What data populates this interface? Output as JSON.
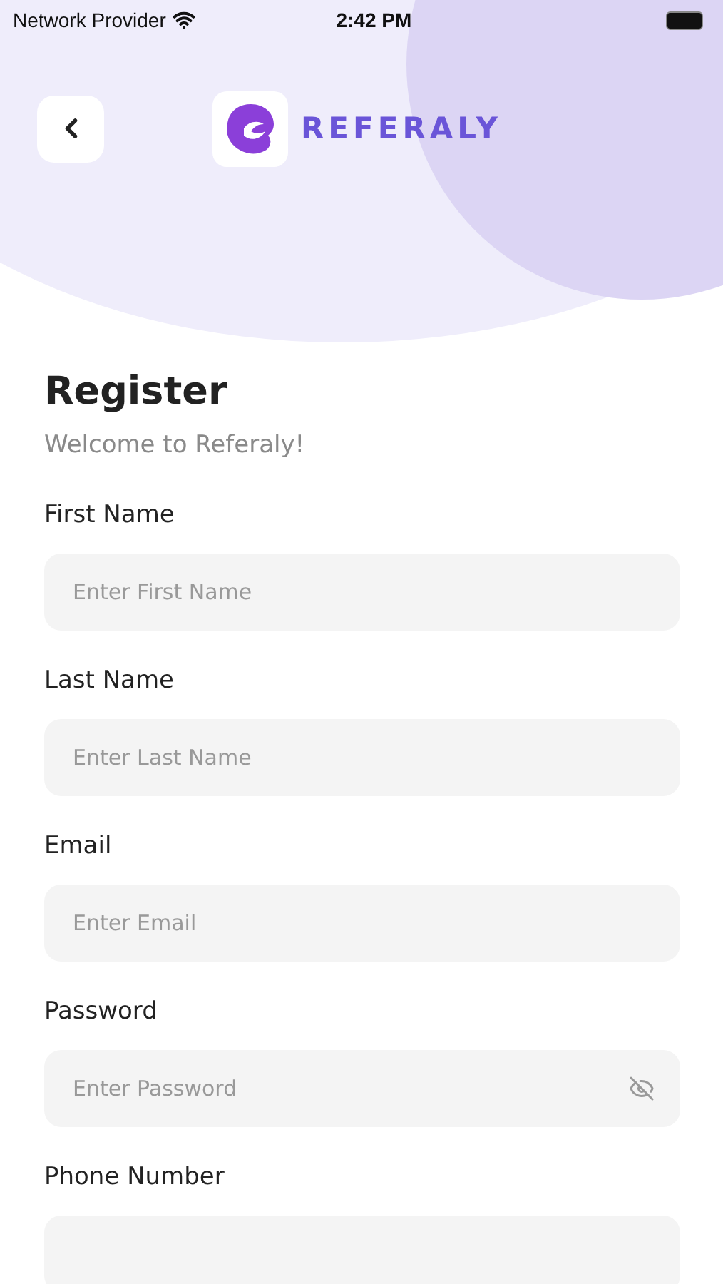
{
  "status_bar": {
    "carrier": "Network Provider",
    "time": "2:42 PM"
  },
  "header": {
    "brand": "REFERALY"
  },
  "title": "Register",
  "subtitle": "Welcome to Referaly!",
  "fields": [
    {
      "label": "First Name",
      "placeholder": "Enter First Name",
      "kind": "text"
    },
    {
      "label": "Last Name",
      "placeholder": "Enter Last Name",
      "kind": "text"
    },
    {
      "label": "Email",
      "placeholder": "Enter Email",
      "kind": "text"
    },
    {
      "label": "Password",
      "placeholder": "Enter Password",
      "kind": "password"
    },
    {
      "label": "Phone Number",
      "kind": "phone"
    }
  ]
}
